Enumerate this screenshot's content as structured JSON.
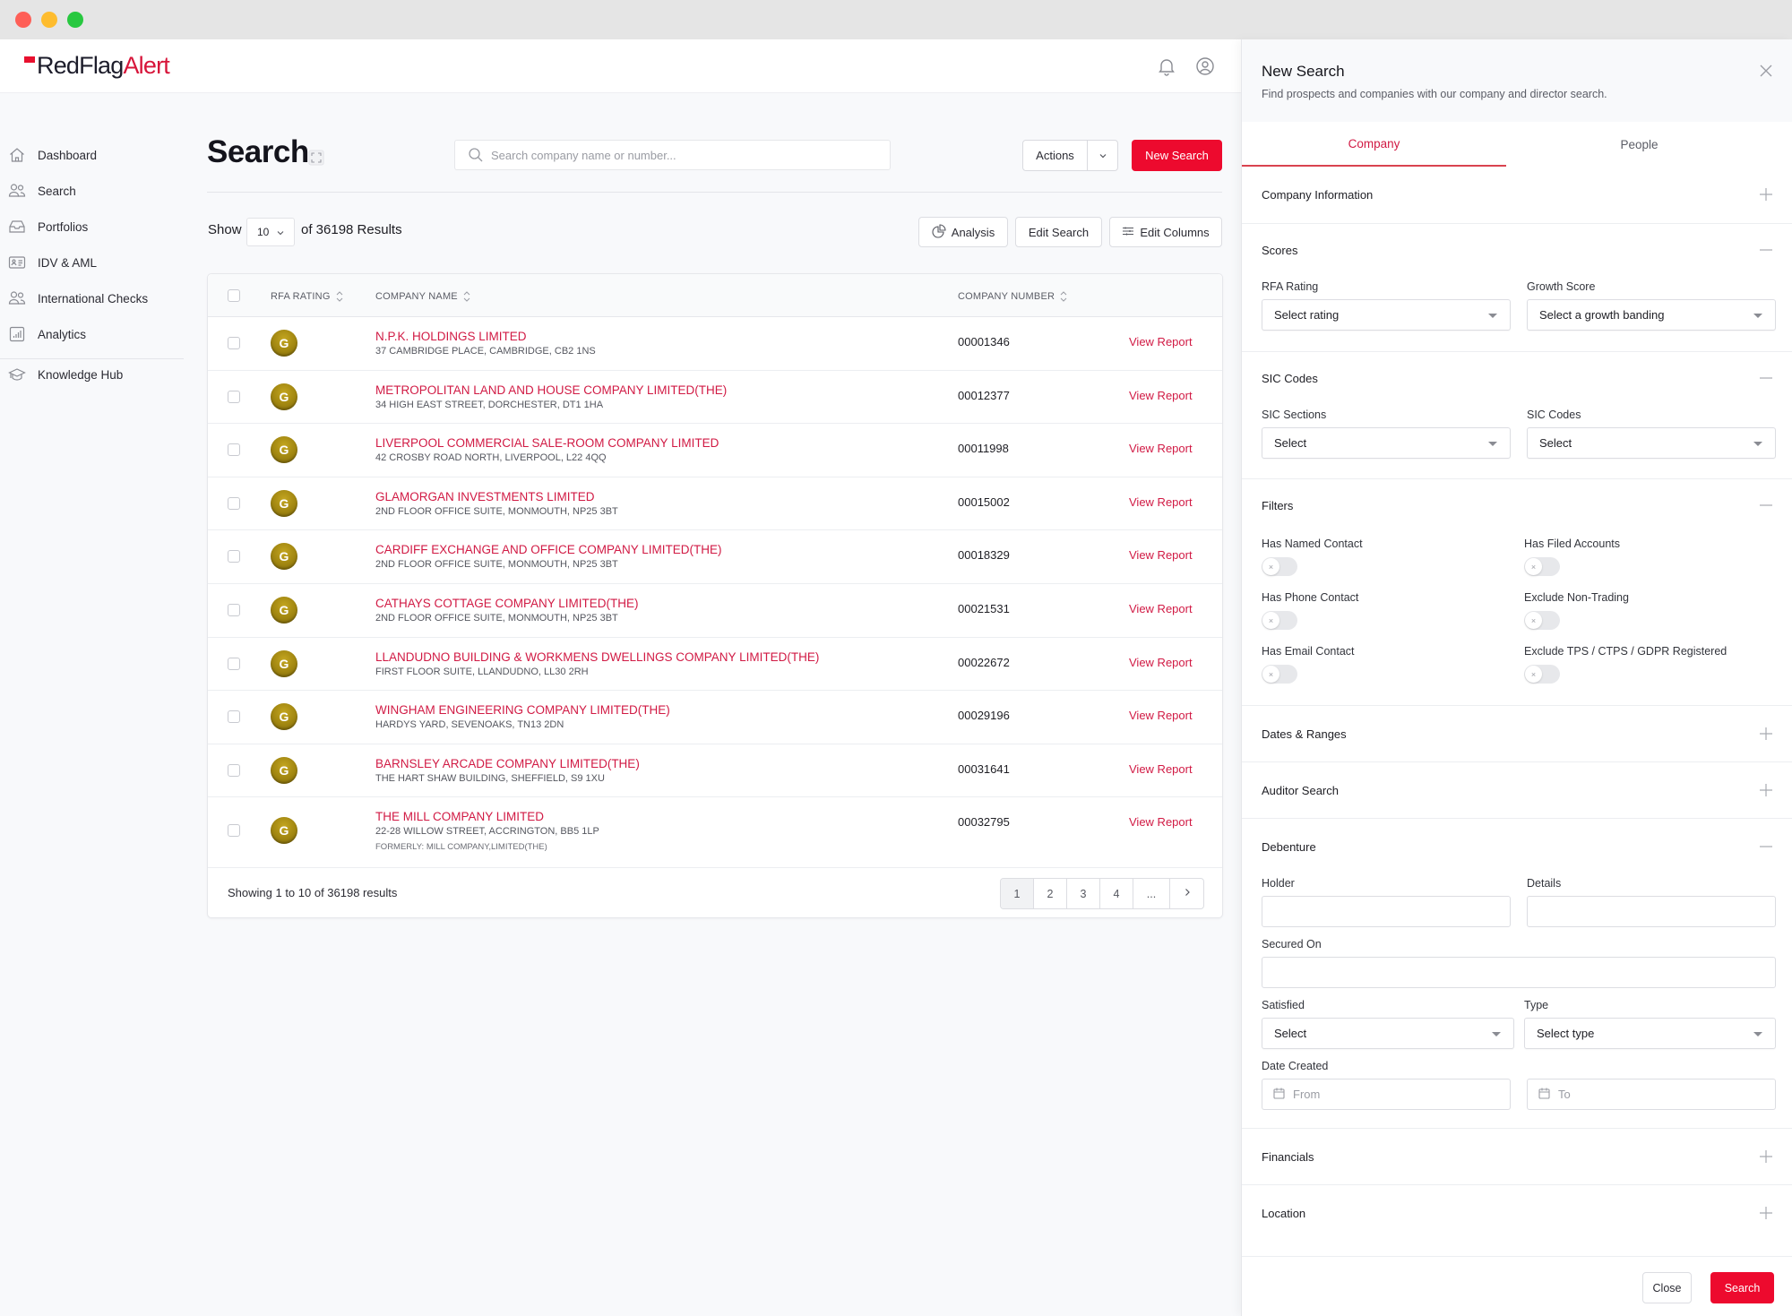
{
  "window": {
    "controls": [
      "close",
      "minimize",
      "maximize"
    ]
  },
  "brand": {
    "logo_dark": "RedFlag",
    "logo_red": "Alert",
    "accent_color": "#ed0a2e",
    "link_color": "#d11a44"
  },
  "topbar": {
    "icons": [
      "bell-icon",
      "user-circle-icon"
    ]
  },
  "sidebar": {
    "items": [
      {
        "label": "Dashboard",
        "icon": "home-icon"
      },
      {
        "label": "Search",
        "icon": "users-icon"
      },
      {
        "label": "Portfolios",
        "icon": "inbox-icon"
      },
      {
        "label": "IDV & AML",
        "icon": "id-card-icon"
      },
      {
        "label": "International Checks",
        "icon": "users-icon"
      },
      {
        "label": "Analytics",
        "icon": "bar-chart-icon"
      },
      {
        "label": "Knowledge Hub",
        "icon": "graduation-cap-icon"
      }
    ]
  },
  "main": {
    "title": "Search",
    "search_placeholder": "Search company name or number...",
    "actions_label": "Actions",
    "new_search_label": "New Search",
    "show_label": "Show",
    "show_value": "10",
    "results_label": "of 36198 Results",
    "tools": {
      "analysis": "Analysis",
      "edit_search": "Edit Search",
      "edit_columns": "Edit Columns"
    }
  },
  "table": {
    "headers": {
      "rating": "RFA RATING",
      "name": "COMPANY NAME",
      "number": "COMPANY NUMBER"
    },
    "rows": [
      {
        "rating": "G",
        "name": "N.P.K. HOLDINGS LIMITED",
        "address": "37 CAMBRIDGE PLACE, CAMBRIDGE, CB2 1NS",
        "number": "00001346",
        "action": "View Report"
      },
      {
        "rating": "G",
        "name": "METROPOLITAN LAND AND HOUSE COMPANY LIMITED(THE)",
        "address": "34 HIGH EAST STREET, DORCHESTER, DT1 1HA",
        "number": "00012377",
        "action": "View Report"
      },
      {
        "rating": "G",
        "name": "LIVERPOOL COMMERCIAL SALE-ROOM COMPANY LIMITED",
        "address": "42 CROSBY ROAD NORTH, LIVERPOOL, L22 4QQ",
        "number": "00011998",
        "action": "View Report"
      },
      {
        "rating": "G",
        "name": "GLAMORGAN INVESTMENTS LIMITED",
        "address": "2ND FLOOR OFFICE SUITE, MONMOUTH, NP25 3BT",
        "number": "00015002",
        "action": "View Report"
      },
      {
        "rating": "G",
        "name": "CARDIFF EXCHANGE AND OFFICE COMPANY LIMITED(THE)",
        "address": "2ND FLOOR OFFICE SUITE, MONMOUTH, NP25 3BT",
        "number": "00018329",
        "action": "View Report"
      },
      {
        "rating": "G",
        "name": "CATHAYS COTTAGE COMPANY LIMITED(THE)",
        "address": "2ND FLOOR OFFICE SUITE, MONMOUTH, NP25 3BT",
        "number": "00021531",
        "action": "View Report"
      },
      {
        "rating": "G",
        "name": "LLANDUDNO BUILDING & WORKMENS DWELLINGS COMPANY LIMITED(THE)",
        "address": "FIRST FLOOR SUITE, LLANDUDNO, LL30 2RH",
        "number": "00022672",
        "action": "View Report"
      },
      {
        "rating": "G",
        "name": "WINGHAM ENGINEERING COMPANY LIMITED(THE)",
        "address": "HARDYS YARD, SEVENOAKS, TN13 2DN",
        "number": "00029196",
        "action": "View Report"
      },
      {
        "rating": "G",
        "name": "BARNSLEY ARCADE COMPANY LIMITED(THE)",
        "address": "THE HART SHAW BUILDING, SHEFFIELD, S9 1XU",
        "number": "00031641",
        "action": "View Report"
      },
      {
        "rating": "G",
        "name": "THE MILL COMPANY LIMITED",
        "address": "22-28 WILLOW STREET, ACCRINGTON, BB5 1LP",
        "former": "FORMERLY: MILL COMPANY,LIMITED(THE)",
        "number": "00032795",
        "action": "View Report"
      }
    ],
    "footer_text": "Showing 1 to 10 of 36198 results",
    "pagination": {
      "pages": [
        "1",
        "2",
        "3",
        "4",
        "..."
      ],
      "current": "1"
    }
  },
  "panel": {
    "title": "New Search",
    "subtitle": "Find prospects and companies with our company and director search.",
    "tabs": {
      "company": "Company",
      "people": "People",
      "active": "Company"
    },
    "sections": {
      "company_info": "Company Information",
      "scores": "Scores",
      "sic": "SIC Codes",
      "filters": "Filters",
      "dates": "Dates & Ranges",
      "auditor": "Auditor Search",
      "debenture": "Debenture",
      "financials": "Financials",
      "location": "Location"
    },
    "scores": {
      "rfa_label": "RFA Rating",
      "rfa_value": "Select rating",
      "growth_label": "Growth Score",
      "growth_value": "Select a growth banding"
    },
    "sic": {
      "sections_label": "SIC Sections",
      "sections_value": "Select",
      "codes_label": "SIC Codes",
      "codes_value": "Select"
    },
    "filters": [
      {
        "label": "Has Named Contact",
        "on": false
      },
      {
        "label": "Has Filed Accounts",
        "on": false
      },
      {
        "label": "Has Phone Contact",
        "on": false
      },
      {
        "label": "Exclude Non-Trading",
        "on": false
      },
      {
        "label": "Has Email Contact",
        "on": false
      },
      {
        "label": "Exclude TPS / CTPS / GDPR Registered",
        "on": false
      }
    ],
    "debenture": {
      "holder_label": "Holder",
      "holder_value": "",
      "details_label": "Details",
      "details_value": "",
      "secured_label": "Secured On",
      "secured_value": "",
      "satisfied_label": "Satisfied",
      "satisfied_value": "Select",
      "type_label": "Type",
      "type_value": "Select type",
      "date_label": "Date Created",
      "from_placeholder": "From",
      "to_placeholder": "To"
    },
    "footer": {
      "close": "Close",
      "search": "Search"
    },
    "toggle_off_glyph": "×"
  }
}
